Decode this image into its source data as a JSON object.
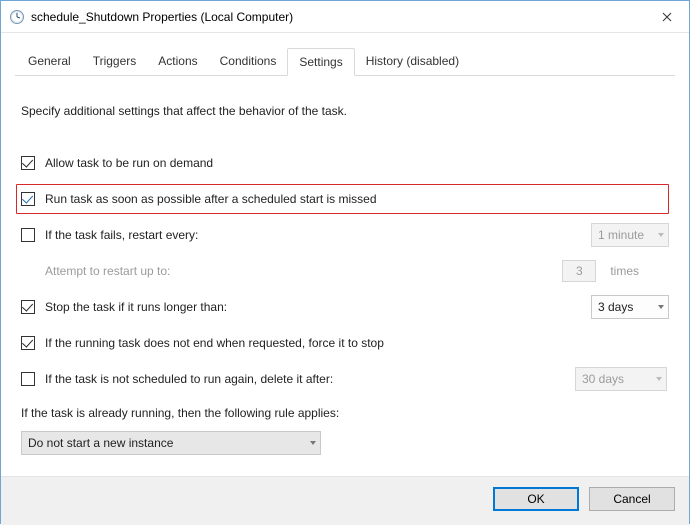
{
  "window": {
    "title": "schedule_Shutdown Properties (Local Computer)"
  },
  "tabs": {
    "general": "General",
    "triggers": "Triggers",
    "actions": "Actions",
    "conditions": "Conditions",
    "settings": "Settings",
    "history": "History (disabled)"
  },
  "settings": {
    "intro": "Specify additional settings that affect the behavior of the task.",
    "allow_on_demand": "Allow task to be run on demand",
    "run_asap": "Run task as soon as possible after a scheduled start is missed",
    "if_fails_restart": "If the task fails, restart every:",
    "restart_interval": "1 minute",
    "attempt_restart_label": "Attempt to restart up to:",
    "attempt_restart_value": "3",
    "attempt_restart_suffix": "times",
    "stop_if_longer": "Stop the task if it runs longer than:",
    "stop_if_longer_value": "3 days",
    "force_stop": "If the running task does not end when requested, force it to stop",
    "delete_after": "If the task is not scheduled to run again, delete it after:",
    "delete_after_value": "30 days",
    "already_running_label": "If the task is already running, then the following rule applies:",
    "rule_value": "Do not start a new instance"
  },
  "buttons": {
    "ok": "OK",
    "cancel": "Cancel"
  }
}
